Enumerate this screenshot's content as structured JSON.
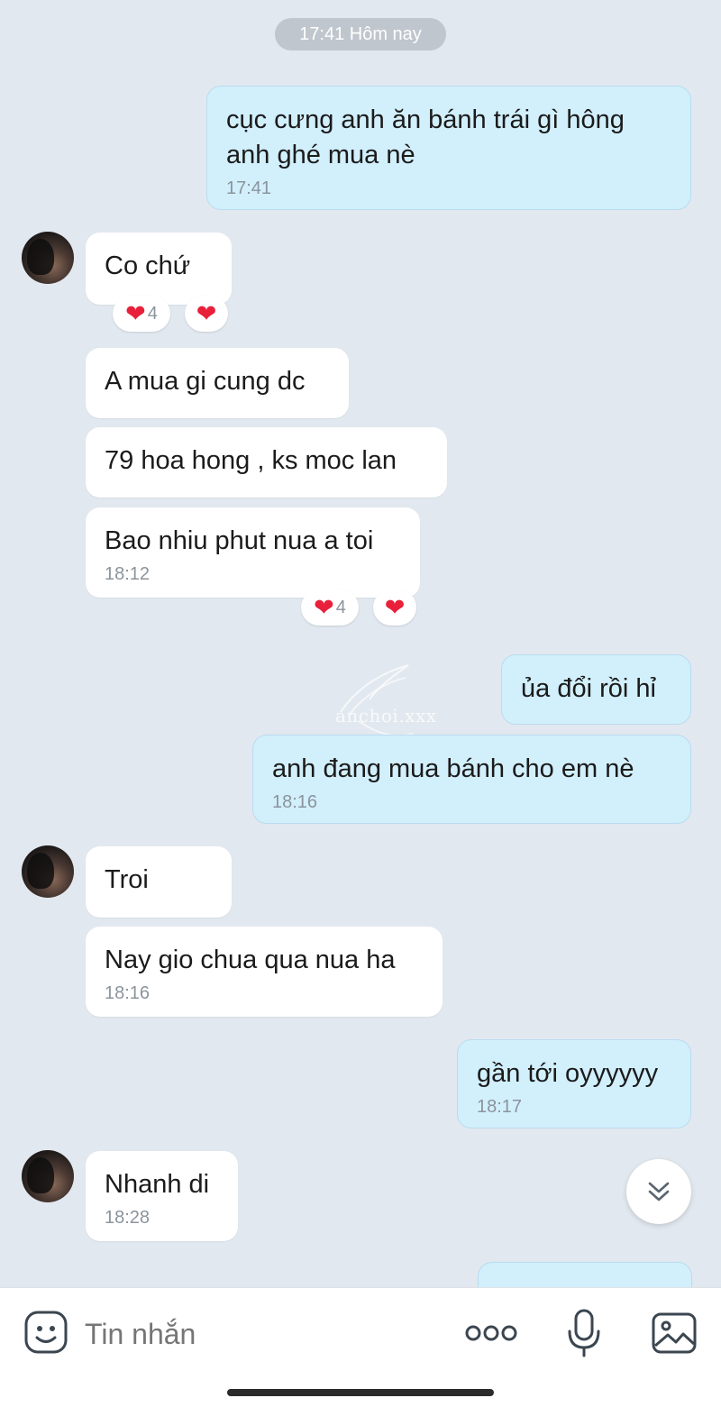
{
  "date_separator": "17:41 Hôm nay",
  "messages": [
    {
      "dir": "out",
      "lines": [
        "cục cưng anh ăn bánh trái gì hông",
        "anh ghé mua nè"
      ],
      "time": "17:41"
    },
    {
      "dir": "in",
      "lines": [
        "Co chứ"
      ]
    },
    {
      "dir": "in",
      "lines": [
        "A mua gi cung dc"
      ]
    },
    {
      "dir": "in",
      "lines": [
        "79 hoa hong , ks moc lan"
      ]
    },
    {
      "dir": "in",
      "lines": [
        "Bao nhiu phut nua a toi"
      ],
      "time": "18:12"
    },
    {
      "dir": "out",
      "lines": [
        "ủa đổi rồi hỉ"
      ]
    },
    {
      "dir": "out",
      "lines": [
        "anh đang mua bánh cho em nè"
      ],
      "time": "18:16"
    },
    {
      "dir": "in",
      "lines": [
        "Troi"
      ]
    },
    {
      "dir": "in",
      "lines": [
        "Nay gio chua qua nua ha"
      ],
      "time": "18:16"
    },
    {
      "dir": "out",
      "lines": [
        "gần tới oyyyyyy"
      ],
      "time": "18:17"
    },
    {
      "dir": "in",
      "lines": [
        "Nhanh di"
      ],
      "time": "18:28"
    }
  ],
  "reactions": {
    "co_chu": {
      "count": "4"
    },
    "bao_nhiu": {
      "count": "4"
    }
  },
  "watermark": "anchoi.xxx",
  "composer": {
    "placeholder": "Tin nhắn"
  },
  "icons": [
    "emoji-icon",
    "more-options-icon",
    "microphone-icon",
    "image-icon",
    "chevron-double-down-icon",
    "heart-icon"
  ],
  "colors": {
    "background": "#e2e8ef",
    "incoming_bubble": "#ffffff",
    "outgoing_bubble": "#d2effc",
    "heart": "#e8203a",
    "timestamp": "#8b949c"
  }
}
